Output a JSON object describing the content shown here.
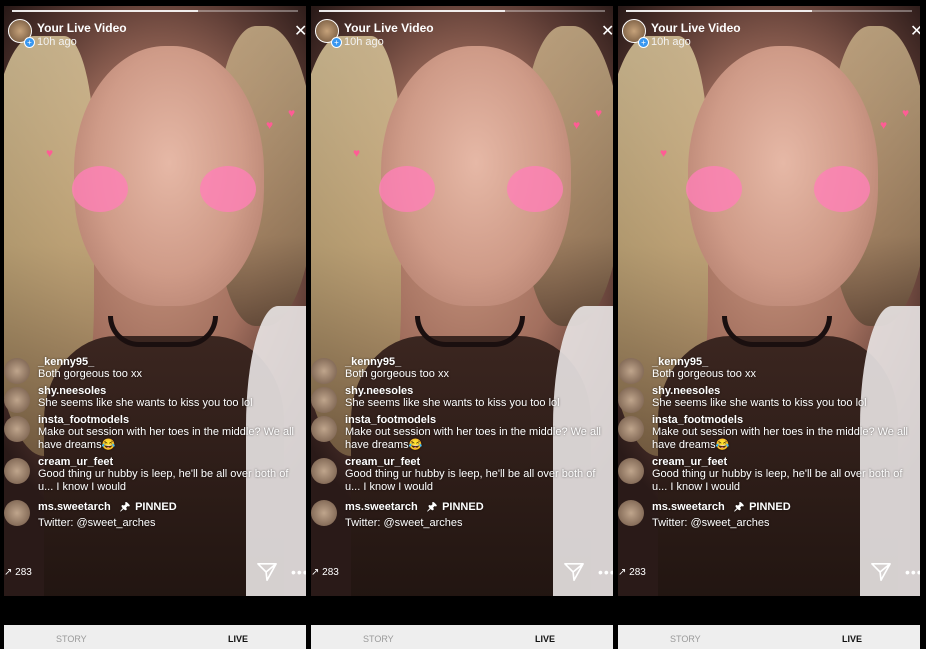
{
  "screens": [
    {
      "header": {
        "title": "Your Live Video",
        "time": "10h ago"
      },
      "comments": [
        {
          "user": "_kenny95_",
          "text": "Both gorgeous too xx"
        },
        {
          "user": "shy.neesoles",
          "text": "She seems like she wants to kiss you too lol"
        },
        {
          "user": "insta_footmodels",
          "text": "Make out session with her toes in the middle? We all have dreams😂"
        },
        {
          "user": "cream_ur_feet",
          "text": "Good thing ur hubby is leep, he'll be all over both of u... I know I would"
        },
        {
          "user": "ms.sweetarch",
          "pinned": "PINNED",
          "text": "Twitter: @sweet_arches"
        }
      ],
      "viewers": "283",
      "tabs": {
        "story": "STORY",
        "live": "LIVE"
      }
    },
    {
      "header": {
        "title": "Your Live Video",
        "time": "10h ago"
      },
      "comments": [
        {
          "user": "_kenny95_",
          "text": "Both gorgeous too xx"
        },
        {
          "user": "shy.neesoles",
          "text": "She seems like she wants to kiss you too lol"
        },
        {
          "user": "insta_footmodels",
          "text": "Make out session with her toes in the middle? We all have dreams😂"
        },
        {
          "user": "cream_ur_feet",
          "text": "Good thing ur hubby is leep, he'll be all over both of u... I know I would"
        },
        {
          "user": "ms.sweetarch",
          "pinned": "PINNED",
          "text": "Twitter: @sweet_arches"
        }
      ],
      "viewers": "283",
      "tabs": {
        "story": "STORY",
        "live": "LIVE"
      }
    },
    {
      "header": {
        "title": "Your Live Video",
        "time": "10h ago"
      },
      "comments": [
        {
          "user": "_kenny95_",
          "text": "Both gorgeous too xx"
        },
        {
          "user": "shy.neesoles",
          "text": "She seems like she wants to kiss you too lol"
        },
        {
          "user": "insta_footmodels",
          "text": "Make out session with her toes in the middle? We all have dreams😂"
        },
        {
          "user": "cream_ur_feet",
          "text": "Good thing ur hubby is leep, he'll be all over both of u... I know I would"
        },
        {
          "user": "ms.sweetarch",
          "pinned": "PINNED",
          "text": "Twitter: @sweet_arches"
        }
      ],
      "viewers": "283",
      "tabs": {
        "story": "STORY",
        "live": "LIVE"
      }
    }
  ],
  "icons": {
    "close": "close-icon",
    "send": "send-icon",
    "more": "more-options-icon",
    "pin": "pin-icon",
    "viewers": "viewers-icon"
  },
  "colors": {
    "accent": "#3897f0",
    "filter_hearts": "#ff7fb6"
  }
}
